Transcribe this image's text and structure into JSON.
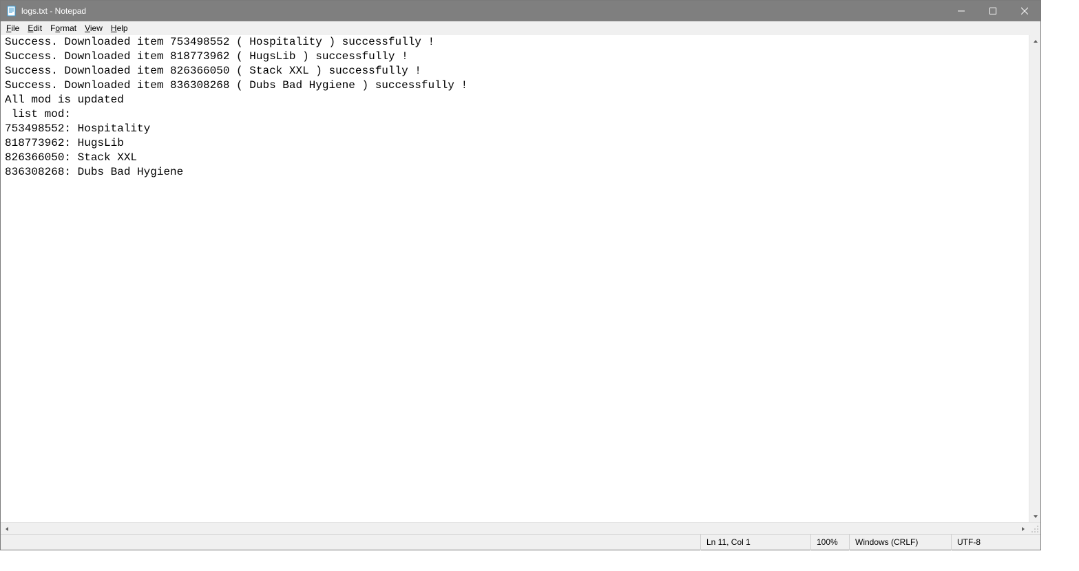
{
  "titlebar": {
    "title": "logs.txt - Notepad"
  },
  "menubar": {
    "file": "File",
    "edit": "Edit",
    "format": "Format",
    "view": "View",
    "help": "Help"
  },
  "text": "Success. Downloaded item 753498552 ( Hospitality ) successfully !\nSuccess. Downloaded item 818773962 ( HugsLib ) successfully !\nSuccess. Downloaded item 826366050 ( Stack XXL ) successfully !\nSuccess. Downloaded item 836308268 ( Dubs Bad Hygiene ) successfully !\nAll mod is updated\n list mod:\n753498552: Hospitality\n818773962: HugsLib\n826366050: Stack XXL\n836308268: Dubs Bad Hygiene",
  "statusbar": {
    "position": "Ln 11, Col 1",
    "zoom": "100%",
    "line_ending": "Windows (CRLF)",
    "encoding": "UTF-8"
  }
}
